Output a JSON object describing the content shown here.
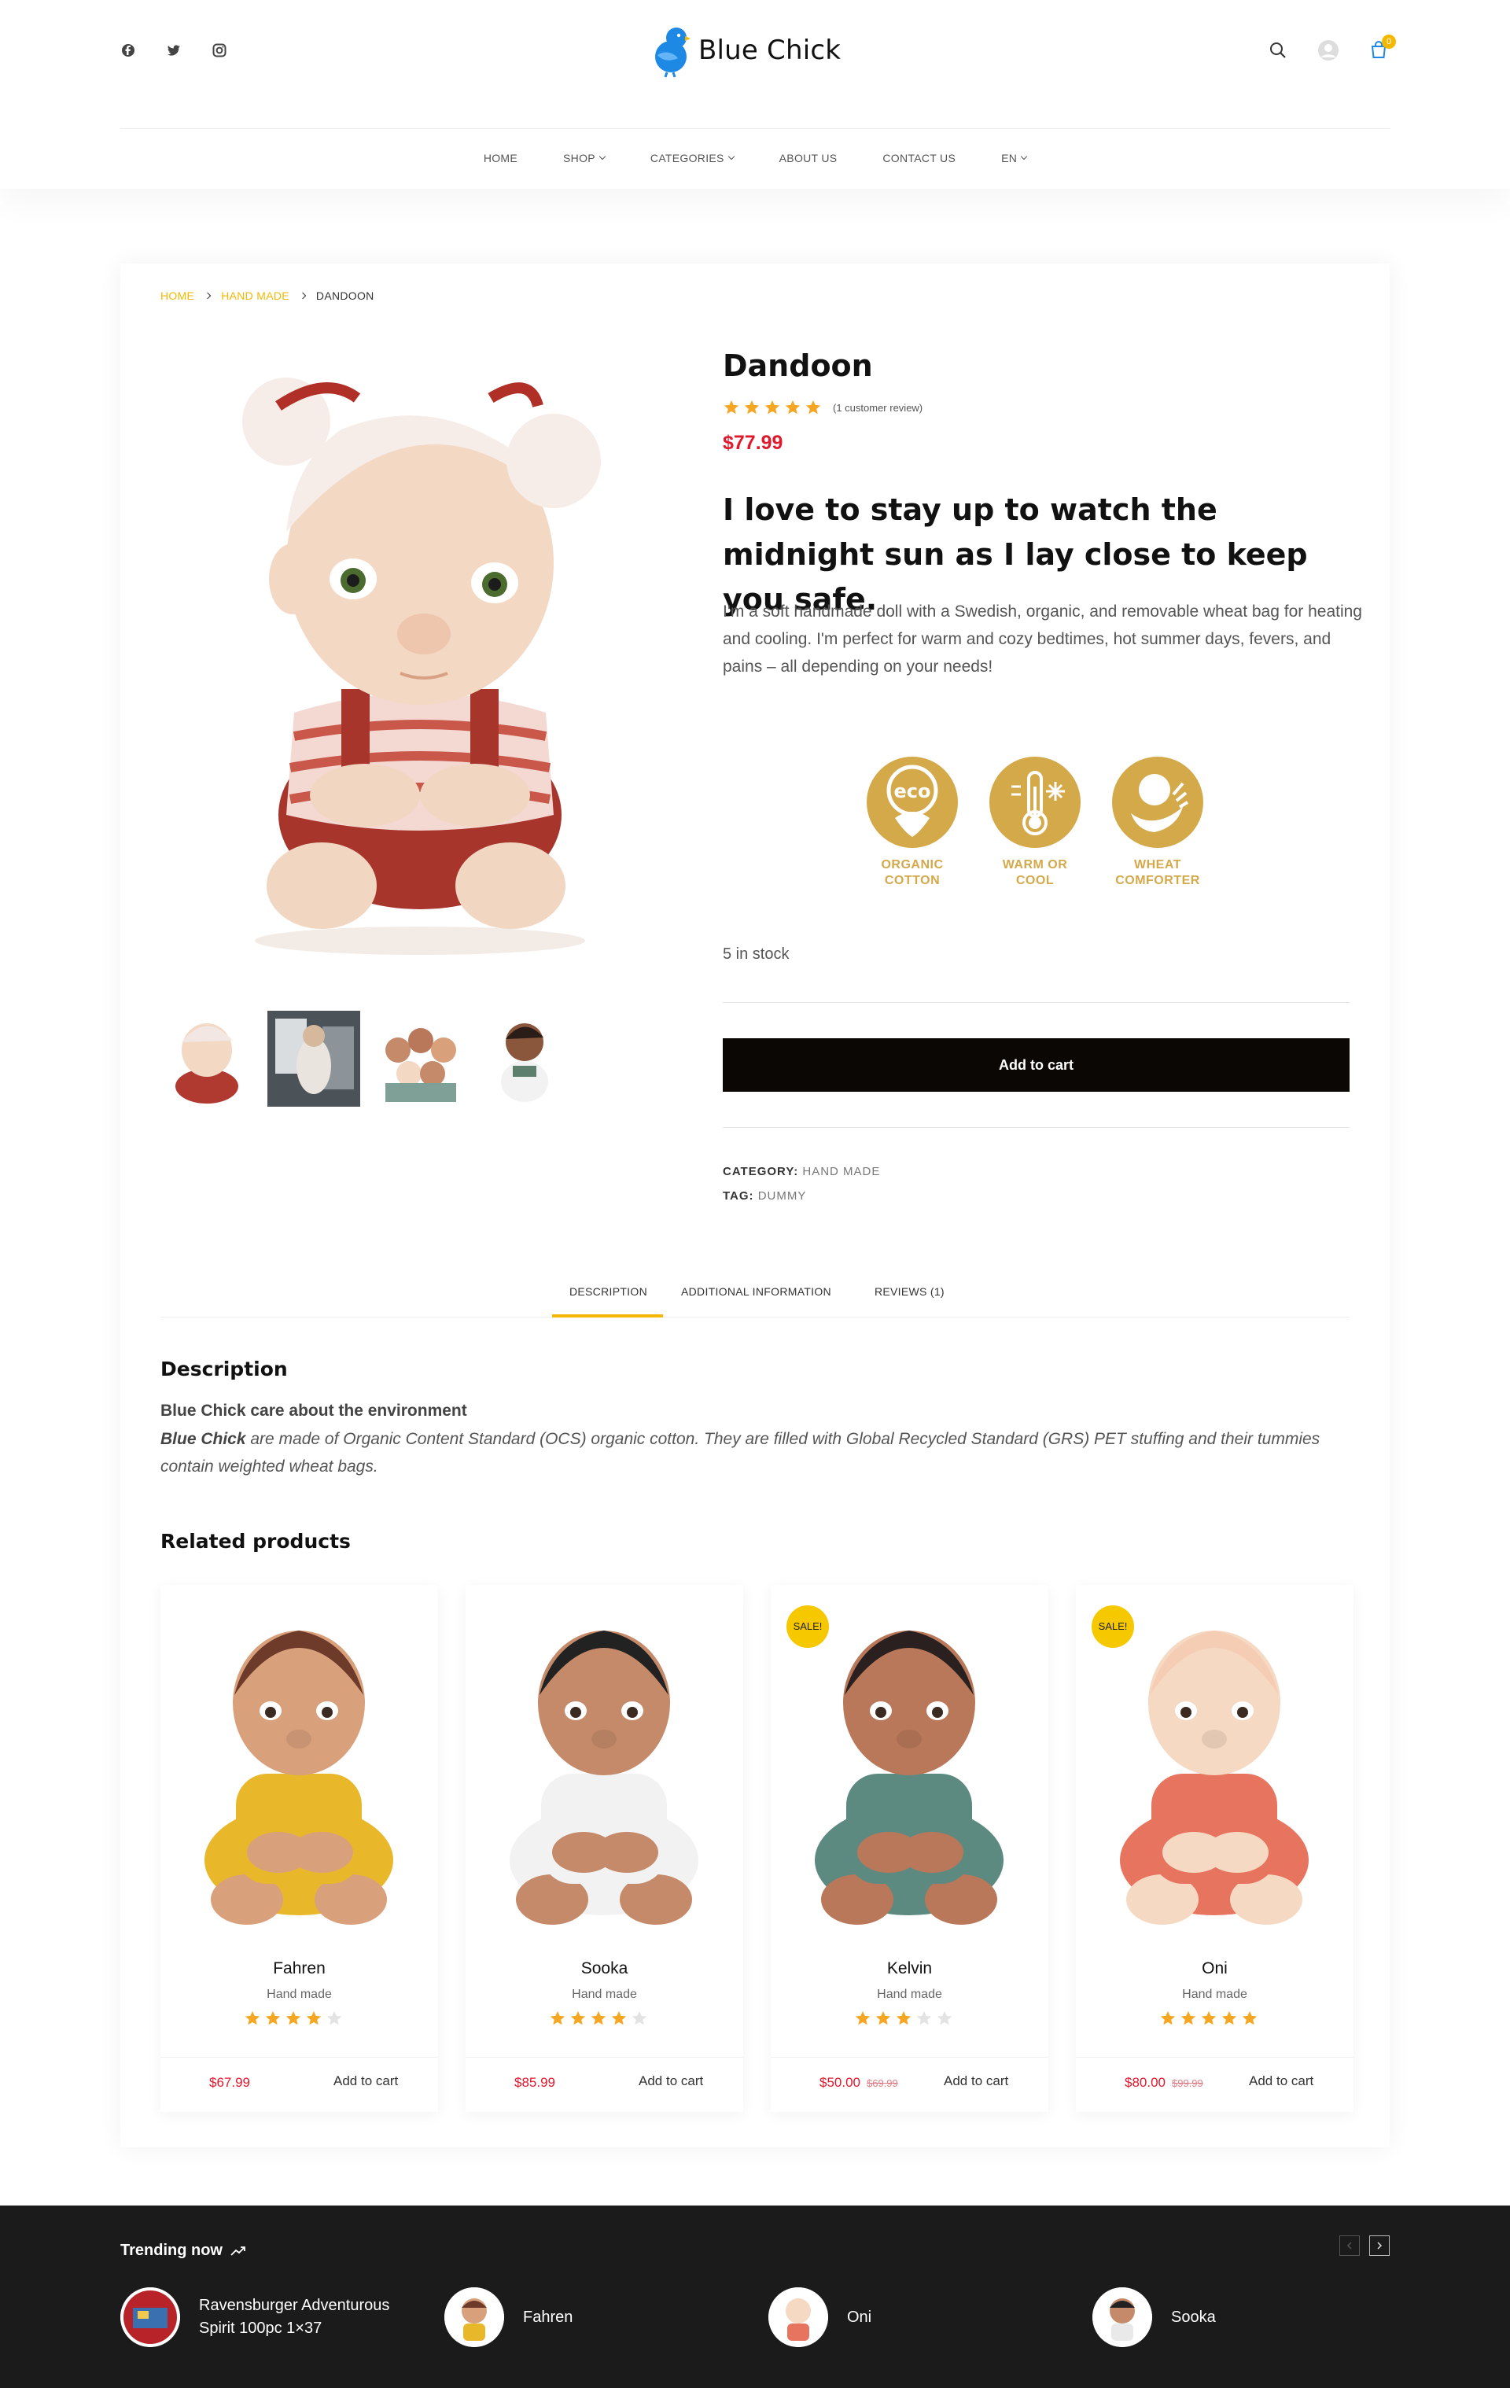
{
  "brand": {
    "name": "Blue Chick",
    "color": "#1e88e5"
  },
  "colors": {
    "accent": "#f5b800",
    "price": "#e0192d",
    "button": "#0b0705",
    "feature": "#d4a94a"
  },
  "social": [
    "facebook-icon",
    "twitter-icon",
    "instagram-icon"
  ],
  "header_icons": {
    "search": "search-icon",
    "account": "user-icon",
    "cart": "cart-icon",
    "cart_count": "0"
  },
  "nav": {
    "home": "HOME",
    "shop": "SHOP",
    "categories": "CATEGORIES",
    "about": "ABOUT US",
    "contact": "CONTACT US",
    "lang": "EN"
  },
  "breadcrumb": {
    "home": "HOME",
    "category": "HAND MADE",
    "current": "DANDOON"
  },
  "product": {
    "title": "Dandoon",
    "rating": 5,
    "review_note": "(1 customer review)",
    "price": "$77.99",
    "tagline": "I love to stay up to watch the midnight sun as I lay close to keep you safe.",
    "short_description": "I'm a soft handmade doll with a Swedish, organic, and removable wheat bag for heating and cooling. I'm perfect for warm and cozy bedtimes, hot summer days, fevers, and pains – all depending on your needs!",
    "features": [
      {
        "line1": "ORGANIC",
        "line2": "COTTON",
        "icon": "eco-cotton-icon"
      },
      {
        "line1": "WARM OR",
        "line2": "COOL",
        "icon": "thermometer-snowflake-icon"
      },
      {
        "line1": "WHEAT",
        "line2": "COMFORTER",
        "icon": "wheat-baby-icon"
      }
    ],
    "stock": "5 in stock",
    "add_to_cart": "Add to cart",
    "category_label": "CATEGORY:",
    "category_value": "HAND MADE",
    "tag_label": "TAG:",
    "tag_value": "DUMMY"
  },
  "tabs": {
    "description": "DESCRIPTION",
    "additional": "ADDITIONAL INFORMATION",
    "reviews": "REVIEWS (1)"
  },
  "description": {
    "heading": "Description",
    "subheading": "Blue Chick care about the environment",
    "brand_bold": "Blue Chick",
    "body": "are made of Organic Content Standard (OCS) organic cotton. They are filled with Global Recycled Standard (GRS) PET stuffing and their tummies contain weighted wheat bags."
  },
  "related": {
    "heading": "Related products",
    "sale_label": "SALE!",
    "items": [
      {
        "name": "Fahren",
        "category": "Hand made",
        "rating": 4,
        "price": "$67.99",
        "old_price": "",
        "sale": false,
        "add": "Add to cart",
        "hair": "#6e3b2a",
        "shirt": "#e8b82a",
        "skin": "#d9a07c"
      },
      {
        "name": "Sooka",
        "category": "Hand made",
        "rating": 4,
        "price": "$85.99",
        "old_price": "",
        "sale": false,
        "add": "Add to cart",
        "hair": "#222222",
        "shirt": "#f2f2f2",
        "skin": "#c58a6a"
      },
      {
        "name": "Kelvin",
        "category": "Hand made",
        "rating": 3,
        "price": "$50.00",
        "old_price": "$69.99",
        "sale": true,
        "add": "Add to cart",
        "hair": "#2a2020",
        "shirt": "#5d8a80",
        "skin": "#b9785a"
      },
      {
        "name": "Oni",
        "category": "Hand made",
        "rating": 5,
        "price": "$80.00",
        "old_price": "$99.99",
        "sale": true,
        "add": "Add to cart",
        "hair": "#f4cdb4",
        "shirt": "#e7745f",
        "skin": "#f6d9c3"
      }
    ]
  },
  "trending": {
    "title": "Trending now",
    "items": [
      {
        "name": "Ravensburger Adventurous Spirit 100pc 1×37"
      },
      {
        "name": "Fahren"
      },
      {
        "name": "Oni"
      },
      {
        "name": "Sooka"
      }
    ]
  }
}
